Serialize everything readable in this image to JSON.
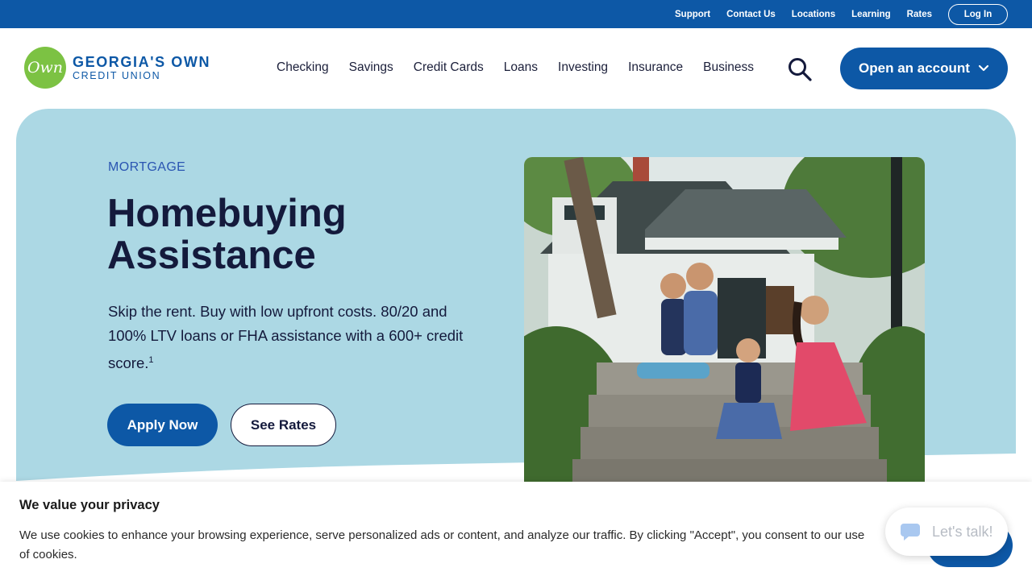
{
  "utility_nav": {
    "links": [
      "Support",
      "Contact Us",
      "Locations",
      "Learning",
      "Rates"
    ],
    "login_label": "Log In"
  },
  "header": {
    "logo": {
      "mark": "Own",
      "line1": "GEORGIA'S OWN",
      "line2": "CREDIT UNION"
    },
    "nav": [
      "Checking",
      "Savings",
      "Credit Cards",
      "Loans",
      "Investing",
      "Insurance",
      "Business"
    ],
    "search_icon": "search-icon",
    "open_account_label": "Open an account",
    "open_account_icon": "chevron-down-icon"
  },
  "hero": {
    "eyebrow": "MORTGAGE",
    "title": "Homebuying Assistance",
    "description": "Skip the rent. Buy with low upfront costs. 80/20 and 100% LTV loans or FHA assistance with a 600+ credit score.",
    "footnote": "1",
    "apply_label": "Apply Now",
    "rates_label": "See Rates"
  },
  "cookie_banner": {
    "title": "We value your privacy",
    "text": "We use cookies to enhance your browsing experience, serve personalized ads or content, and analyze our traffic. By clicking \"Accept\", you consent to our use of cookies."
  },
  "chat": {
    "label": "Let's talk!",
    "icon": "chat-bubble-icon"
  },
  "colors": {
    "brand_blue": "#0d58a6",
    "brand_green": "#7cc243",
    "hero_bg": "#acd8e4",
    "title_navy": "#141a3c"
  }
}
